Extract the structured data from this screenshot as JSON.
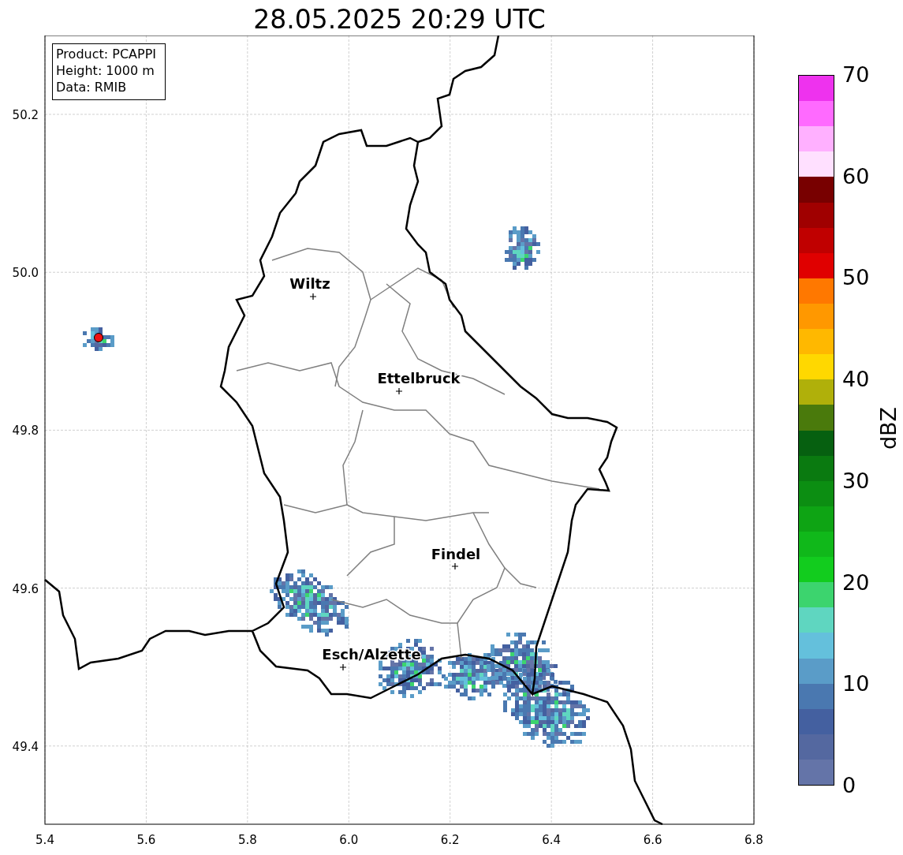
{
  "title": "28.05.2025 20:29 UTC",
  "info": [
    "Product: PCAPPI",
    "Height: 1000 m",
    "Data: RMIB"
  ],
  "xticks": [
    "5.4",
    "5.6",
    "5.8",
    "6.0",
    "6.2",
    "6.4",
    "6.6",
    "6.8"
  ],
  "yticks": [
    "50.2",
    "50.0",
    "49.8",
    "49.6",
    "49.4"
  ],
  "cities": [
    {
      "name": "Wiltz"
    },
    {
      "name": "Ettelbruck"
    },
    {
      "name": "Findel"
    },
    {
      "name": "Esch/Alzette"
    }
  ],
  "colorbar": {
    "label": "dBZ",
    "ticks": [
      "70",
      "60",
      "50",
      "40",
      "30",
      "20",
      "10",
      "0"
    ],
    "bins": [
      {
        "color": "#ee32ee"
      },
      {
        "color": "#ff6aff"
      },
      {
        "color": "#ffb0ff"
      },
      {
        "color": "#ffe0ff"
      },
      {
        "color": "#780000"
      },
      {
        "color": "#a00000"
      },
      {
        "color": "#c00000"
      },
      {
        "color": "#e00000"
      },
      {
        "color": "#ff7800"
      },
      {
        "color": "#ff9800"
      },
      {
        "color": "#ffb800"
      },
      {
        "color": "#ffd800"
      },
      {
        "color": "#b0b00a"
      },
      {
        "color": "#4a7a0c"
      },
      {
        "color": "#066010"
      },
      {
        "color": "#0a7a10"
      },
      {
        "color": "#0c8e12"
      },
      {
        "color": "#0ea414"
      },
      {
        "color": "#10b81a"
      },
      {
        "color": "#12cc1e"
      },
      {
        "color": "#3cd46e"
      },
      {
        "color": "#5fd6c0"
      },
      {
        "color": "#64c0dc"
      },
      {
        "color": "#5a9cc8"
      },
      {
        "color": "#4a78b0"
      },
      {
        "color": "#4460a0"
      },
      {
        "color": "#5468a0"
      },
      {
        "color": "#6474a8"
      }
    ]
  }
}
